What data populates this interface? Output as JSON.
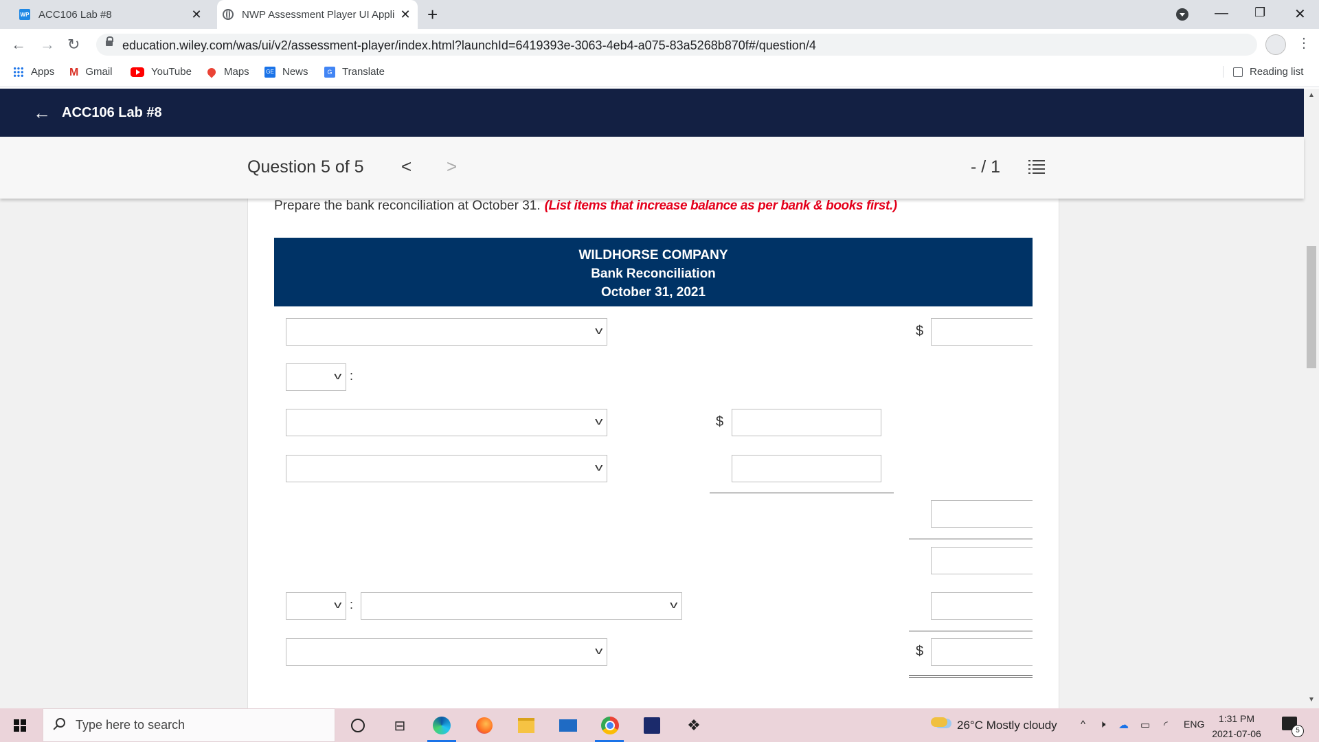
{
  "browser": {
    "tabs": [
      {
        "title": "ACC106 Lab #8",
        "favicon": "wp-icon",
        "active": false
      },
      {
        "title": "NWP Assessment Player UI Appli",
        "favicon": "globe-icon",
        "active": true
      }
    ],
    "new_tab_label": "+",
    "url": "education.wiley.com/was/ui/v2/assessment-player/index.html?launchId=6419393e-3063-4eb4-a075-83a5268b870f#/question/4",
    "bookmarks": [
      {
        "label": "Apps",
        "icon": "apps-grid-icon"
      },
      {
        "label": "Gmail",
        "icon": "gmail-icon"
      },
      {
        "label": "YouTube",
        "icon": "youtube-icon"
      },
      {
        "label": "Maps",
        "icon": "maps-pin-icon"
      },
      {
        "label": "News",
        "icon": "news-icon"
      },
      {
        "label": "Translate",
        "icon": "translate-icon"
      }
    ],
    "reading_list_label": "Reading list"
  },
  "app": {
    "title": "ACC106 Lab #8",
    "question_label": "Question 5 of 5",
    "score": "- / 1",
    "header_color": "#132043"
  },
  "question": {
    "instruction": "Prepare the bank reconciliation at October 31.",
    "instruction_emphasis": "(List items that increase balance as per bank & books first.)",
    "emphasis_color": "#e4001b"
  },
  "reconciliation": {
    "company": "WILDHORSE COMPANY",
    "title": "Bank Reconciliation",
    "date": "October 31, 2021",
    "header_color": "#003366",
    "currency_symbol": "$",
    "colon": ":"
  },
  "taskbar": {
    "search_placeholder": "Type here to search",
    "weather": "26°C  Mostly cloudy",
    "language": "ENG",
    "time": "1:31 PM",
    "date": "2021-07-06",
    "notification_count": "5"
  }
}
